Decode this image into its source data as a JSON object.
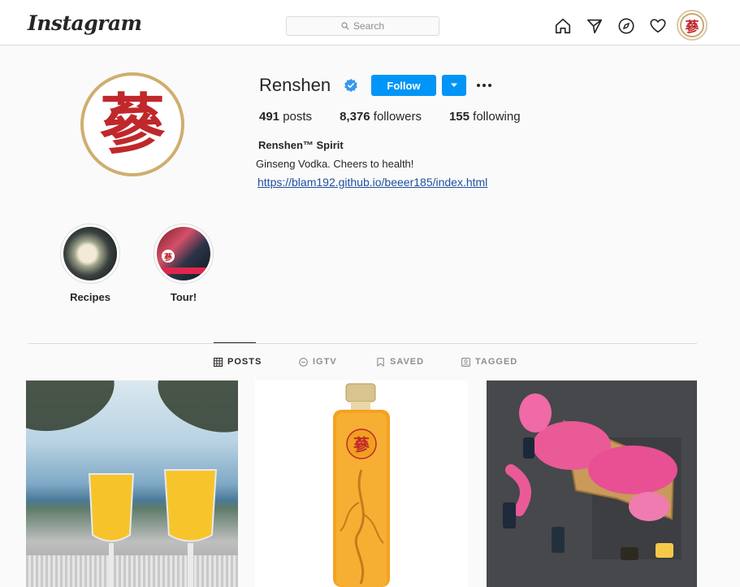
{
  "header": {
    "logo": "Instagram",
    "search_placeholder": "Search",
    "icons": [
      "home-icon",
      "direct-icon",
      "explore-icon",
      "activity-heart-icon",
      "profile-avatar"
    ]
  },
  "profile": {
    "username": "Renshen",
    "verified": true,
    "follow_label": "Follow",
    "avatar_glyph": "蔘",
    "stats": {
      "posts_count": "491",
      "posts_label": "posts",
      "followers_count": "8,376",
      "followers_label": "followers",
      "following_count": "155",
      "following_label": "following"
    },
    "full_name": "Renshen™ Spirit",
    "bio": "Ginseng Vodka. Cheers to health!",
    "link": "https://blam192.github.io/beeer185/index.html"
  },
  "highlights": [
    {
      "label": "Recipes"
    },
    {
      "label": "Tour!"
    }
  ],
  "tabs": [
    {
      "label": "POSTS",
      "active": true
    },
    {
      "label": "IGTV",
      "active": false
    },
    {
      "label": "SAVED",
      "active": false
    },
    {
      "label": "TAGGED",
      "active": false
    }
  ],
  "posts": [
    {
      "alt": "two mimosa glasses by the sea"
    },
    {
      "alt": "renshen ginseng vodka bottle"
    },
    {
      "alt": "pink panther plush with mini bottles"
    }
  ],
  "colors": {
    "accent": "#0095f6",
    "brand_red": "#c0282b",
    "gold": "#cfae6e"
  }
}
